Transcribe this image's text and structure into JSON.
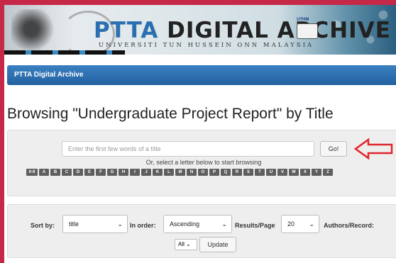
{
  "banner": {
    "title_accent": "PTTA",
    "title_rest": " DIGITAL ARCHIVE",
    "subtitle": "UNIVERSITI TUN HUSSEIN ONN MALAYSIA",
    "logo_text": "UTHM"
  },
  "navbar": {
    "brand": "PTTA Digital Archive"
  },
  "page": {
    "heading": "Browsing \"Undergraduate Project Report\" by Title"
  },
  "browse": {
    "search_placeholder": "Enter the first few words of a title",
    "go_label": "Go!",
    "hint": "Or, select a letter below to start browsing",
    "letters": [
      "0-9",
      "A",
      "B",
      "C",
      "D",
      "E",
      "F",
      "G",
      "H",
      "I",
      "J",
      "K",
      "L",
      "M",
      "N",
      "O",
      "P",
      "Q",
      "R",
      "S",
      "T",
      "U",
      "V",
      "W",
      "X",
      "Y",
      "Z"
    ]
  },
  "sort": {
    "sort_by_label": "Sort by:",
    "sort_by_value": "title",
    "in_order_label": "In order:",
    "in_order_value": "Ascending",
    "results_label": "Results/Page",
    "results_value": "20",
    "authors_label": "Authors/Record:",
    "authors_value": "All",
    "update_label": "Update"
  },
  "colors": {
    "frame": "#c62848",
    "nav": "#2a6aac",
    "arrow": "#e0252b"
  }
}
